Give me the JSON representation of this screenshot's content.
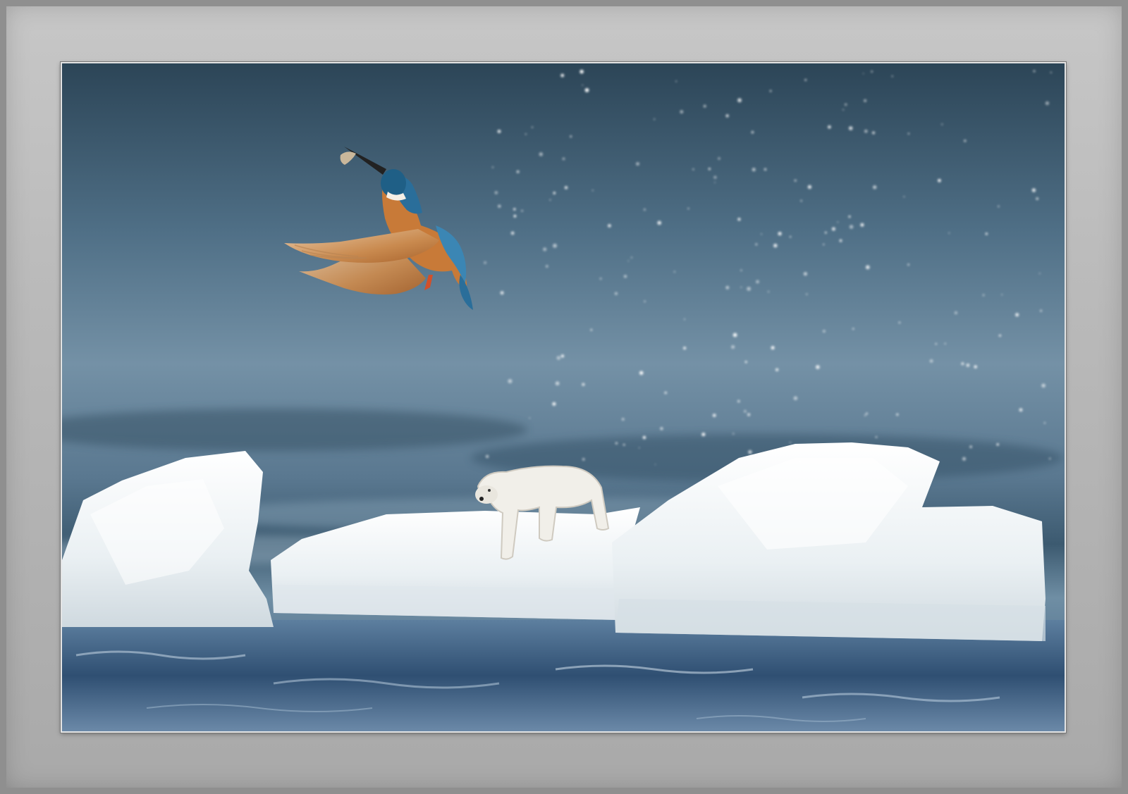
{
  "image": {
    "subject": "kingfisher-with-fish-above-ice-floe-with-polar-bear-figurine",
    "palette": {
      "sky_top": "#2f4a5c",
      "sky_mid": "#5f7f96",
      "water": "#3f5f80",
      "ice": "#eef2f4",
      "bird_orange": "#c77a3a",
      "bird_blue": "#2a6e9a",
      "frame_gray": "#b9b9b9"
    }
  }
}
